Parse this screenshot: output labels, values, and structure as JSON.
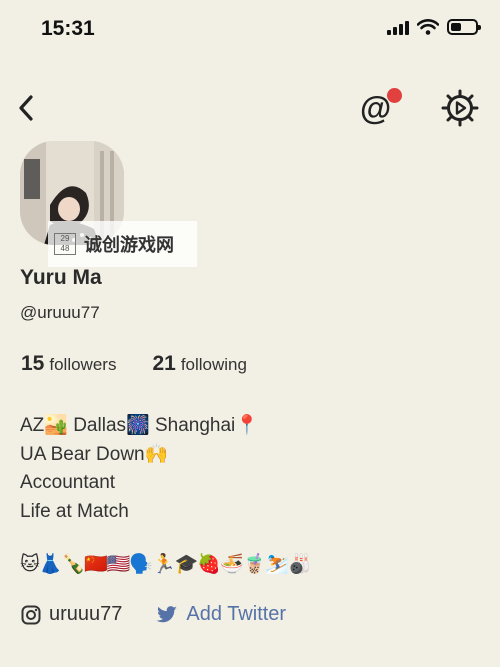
{
  "status_bar": {
    "time": "15:31"
  },
  "header": {
    "back_icon": "chevron-left-icon",
    "mentions_icon": "at-icon",
    "settings_icon": "gear-play-icon",
    "notification_color": "#e0403e"
  },
  "watermark": {
    "logo_text": "29 48",
    "text": "诚创游戏网"
  },
  "profile": {
    "name": "Yuru Ma",
    "handle": "@uruuu77",
    "followers_count": "15",
    "followers_label": "followers",
    "following_count": "21",
    "following_label": "following",
    "bio": [
      "AZ🏜️ Dallas🎆 Shanghai📍",
      "UA Bear Down🙌",
      "Accountant",
      "Life at Match"
    ],
    "emojis": "🐱👗🍾🇨🇳🇺🇸🗣️🏃🎓🍓🍜🧋⛷️🎳"
  },
  "socials": {
    "instagram_handle": "uruuu77",
    "twitter_label": "Add Twitter",
    "twitter_color": "#5673a8"
  }
}
